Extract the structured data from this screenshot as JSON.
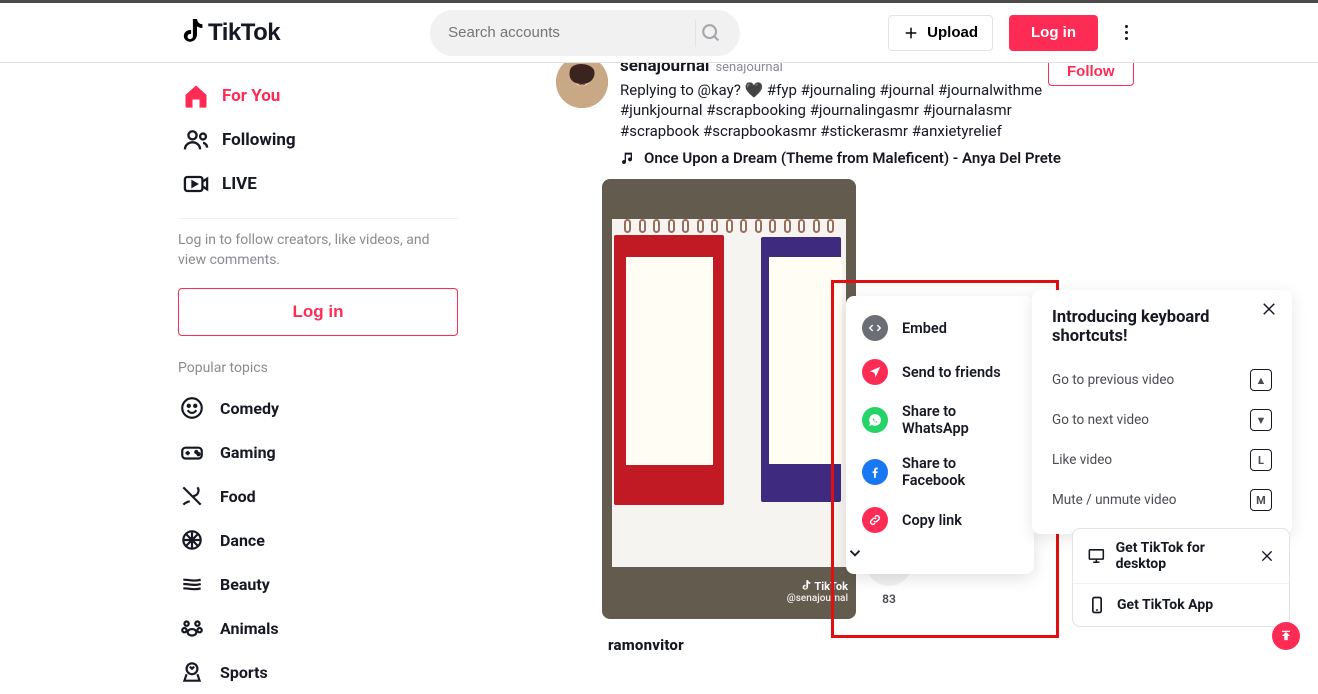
{
  "header": {
    "logo_text": "TikTok",
    "search_placeholder": "Search accounts",
    "upload_label": "Upload",
    "login_label": "Log in"
  },
  "sidebar": {
    "nav": [
      {
        "label": "For You",
        "active": true
      },
      {
        "label": "Following"
      },
      {
        "label": "LIVE"
      }
    ],
    "login_hint": "Log in to follow creators, like videos, and view comments.",
    "login_button": "Log in",
    "popular_header": "Popular topics",
    "topics": [
      {
        "label": "Comedy"
      },
      {
        "label": "Gaming"
      },
      {
        "label": "Food"
      },
      {
        "label": "Dance"
      },
      {
        "label": "Beauty"
      },
      {
        "label": "Animals"
      },
      {
        "label": "Sports"
      }
    ]
  },
  "post": {
    "author_name": "senajournal",
    "author_handle": "senajournal",
    "caption": "Replying to @kay? 🖤 #fyp #journaling #journal #journalwithme #junkjournal #scrapbooking #journalingasmr #journalasmr #scrapbook #scrapbookasmr #stickerasmr #anxietyrelief",
    "music": "Once Upon a Dream (Theme from Maleficent) - Anya Del Prete",
    "follow_label": "Follow",
    "watermark_title": "TikTok",
    "watermark_handle": "@senajournal",
    "share_count": "83"
  },
  "share_menu": {
    "items": [
      {
        "label": "Embed",
        "icon": "embed",
        "bg": "#6b6e76"
      },
      {
        "label": "Send to friends",
        "icon": "send",
        "bg": "#fe2c55"
      },
      {
        "label": "Share to WhatsApp",
        "icon": "whatsapp",
        "bg": "#25D366"
      },
      {
        "label": "Share to Facebook",
        "icon": "facebook",
        "bg": "#1877F2"
      },
      {
        "label": "Copy link",
        "icon": "link",
        "bg": "#fe2c55"
      }
    ]
  },
  "keyboard_panel": {
    "title": "Introducing keyboard shortcuts!",
    "rows": [
      {
        "label": "Go to previous video",
        "key": "▲"
      },
      {
        "label": "Go to next video",
        "key": "▼"
      },
      {
        "label": "Like video",
        "key": "L"
      },
      {
        "label": "Mute / unmute video",
        "key": "M"
      }
    ]
  },
  "get_app": {
    "desktop": "Get TikTok for desktop",
    "mobile": "Get TikTok App"
  },
  "next_post_name": "ramonvitor"
}
